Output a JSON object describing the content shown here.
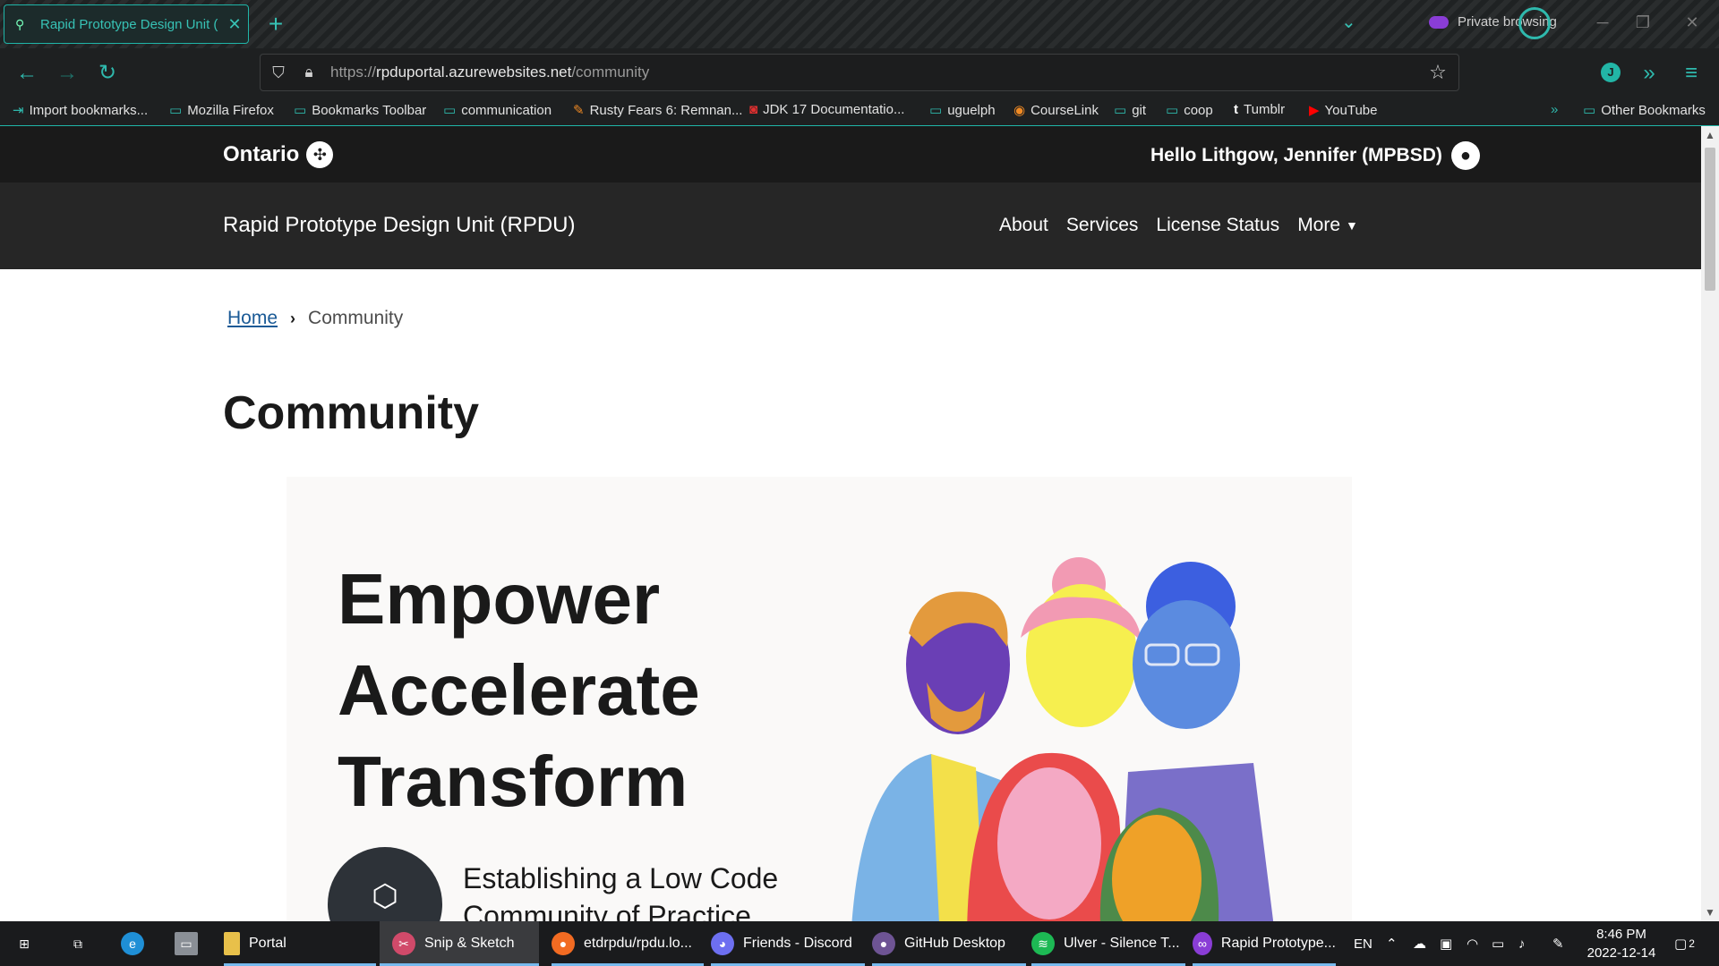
{
  "browser": {
    "tab": {
      "title": "Rapid Prototype Design Unit (",
      "close": "✕"
    },
    "new_tab": "+",
    "private_label": "Private browsing",
    "url": {
      "scheme": "https://",
      "host": "rpduportal.azurewebsites.net",
      "path": "/community"
    },
    "profile_initial": "J",
    "bookmarks": [
      {
        "label": "Import bookmarks...",
        "icon": "import-icon"
      },
      {
        "label": "Mozilla Firefox",
        "icon": "folder-icon"
      },
      {
        "label": "Bookmarks Toolbar",
        "icon": "folder-icon"
      },
      {
        "label": "communication",
        "icon": "folder-icon"
      },
      {
        "label": "Rusty Fears 6: Remnan...",
        "icon": "site-icon"
      },
      {
        "label": "JDK 17 Documentatio...",
        "icon": "oracle-icon"
      },
      {
        "label": "uguelph",
        "icon": "folder-icon"
      },
      {
        "label": "CourseLink",
        "icon": "courselink-icon"
      },
      {
        "label": "git",
        "icon": "folder-icon"
      },
      {
        "label": "coop",
        "icon": "folder-icon"
      },
      {
        "label": "Tumblr",
        "icon": "tumblr-icon"
      },
      {
        "label": "YouTube",
        "icon": "youtube-icon"
      }
    ],
    "other_bookmarks": "Other Bookmarks"
  },
  "site": {
    "brand": "Ontario",
    "greeting": "Hello Lithgow, Jennifer (MPBSD)",
    "title": "Rapid Prototype Design Unit (RPDU)",
    "nav": [
      "About",
      "Services",
      "License Status",
      "More"
    ],
    "breadcrumb": {
      "home": "Home",
      "current": "Community"
    },
    "page_title": "Community",
    "hero": {
      "lines": [
        "Empower",
        "Accelerate",
        "Transform"
      ],
      "subtitle": "Establishing a Low Code Community of Practice"
    }
  },
  "taskbar": {
    "items": [
      "Portal",
      "Snip & Sketch",
      "etdrpdu/rpdu.lo...",
      "Friends - Discord",
      "GitHub Desktop",
      "Ulver - Silence T...",
      "Rapid Prototype..."
    ],
    "language": "EN",
    "time": "8:46 PM",
    "date": "2022-12-14",
    "notifications": "2"
  }
}
